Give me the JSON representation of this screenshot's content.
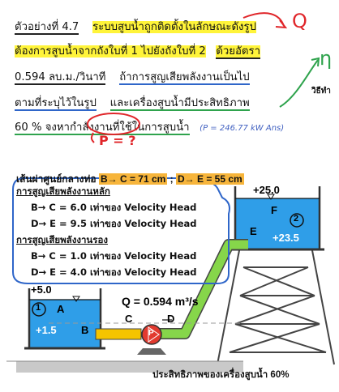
{
  "lesson": {
    "lines": [
      [
        "ตัวอย่างที่ 4.7",
        "ระบบสูบน้ำถูกติดตั้งในลักษณะดังรูป"
      ],
      [
        "ต้องการสูบน้ำจากถังใบที่ 1 ไปยังถังใบที่ 2",
        "ด้วยอัตรา"
      ],
      [
        "0.594 ลบ.ม./วินาที",
        "ถ้าการสูญเสียพลังงานเป็นไป"
      ],
      [
        "ตามที่ระบุไว้ในรูป",
        "และเครื่องสูบน้ำมีประสิทธิภาพ"
      ],
      [
        "60 % จงหากำลังงานที่ใช้ในการสูบน้ำ",
        "(P = 246.77 kW Ans)"
      ]
    ],
    "annotations": {
      "q_mark": "Q",
      "eta_mark": "η",
      "side_note": "วิธีทำ",
      "p_mark": "P = ?"
    }
  },
  "figure": {
    "centerline": {
      "prefix": "เส้นผ่าศูนย์กลางท่อ",
      "bc": "B→ C = 71 cm",
      "sep": ";",
      "de": "D→ E = 55 cm"
    },
    "major_heading": "การสูญเสียพลังงานหลัก",
    "major_items": [
      "B→ C = 6.0 เท่าของ Velocity Head",
      "D→ E = 9.5 เท่าของ Velocity Head"
    ],
    "minor_heading": "การสูญเสียพลังงานรอง",
    "minor_items": [
      "B→ C = 1.0 เท่าของ Velocity Head",
      "D→ E = 4.0 เท่าของ Velocity Head"
    ],
    "tank1": {
      "level_label": "+5.0",
      "number": "1",
      "point_a": "A",
      "pipe_level": "+1.5",
      "point_b": "B"
    },
    "tank2": {
      "level_label": "+25.0",
      "number": "2",
      "point_f": "F",
      "pipe_level": "+23.5",
      "point_e": "E"
    },
    "points": {
      "c": "C",
      "d": "D",
      "pump": "P"
    },
    "flow_label": "Q = 0.594 m³/s",
    "efficiency_label": "ประสิทธิภาพของเครื่องสูบน้ำ 60%"
  },
  "colors": {
    "highlight_yellow": "#fff43a",
    "water_blue": "#2f9ee8",
    "pipe_green": "#86d64a",
    "pump_red": "#e23a2f",
    "annotation_red": "#e0262a",
    "annotation_green": "#2fa34d",
    "centerline_orange": "#f7b53b"
  }
}
